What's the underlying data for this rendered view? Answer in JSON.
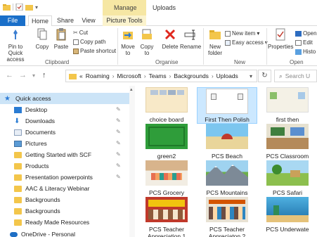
{
  "titlebar": {
    "manage_label": "Manage",
    "title": "Uploads"
  },
  "tabs": {
    "file": "File",
    "home": "Home",
    "share": "Share",
    "view": "View",
    "picture_tools": "Picture Tools"
  },
  "ribbon": {
    "pin_quick_access": "Pin to Quick access",
    "copy": "Copy",
    "paste": "Paste",
    "cut": "Cut",
    "copy_path": "Copy path",
    "paste_shortcut": "Paste shortcut",
    "move_to": "Move to",
    "copy_to": "Copy to",
    "delete": "Delete",
    "rename": "Rename",
    "new_folder": "New folder",
    "new_item": "New item",
    "easy_access": "Easy access",
    "properties": "Properties",
    "open": "Open",
    "edit": "Edit",
    "history": "Histo",
    "group_clipboard": "Clipboard",
    "group_organise": "Organise",
    "group_new": "New",
    "group_open": "Open"
  },
  "address": {
    "overflow": "«",
    "crumbs": [
      "Roaming",
      "Microsoft",
      "Teams",
      "Backgrounds",
      "Uploads"
    ],
    "search_placeholder": "Search U"
  },
  "nav": {
    "quick_access": "Quick access",
    "items": [
      "Desktop",
      "Downloads",
      "Documents",
      "Pictures",
      "Getting Started with SCF",
      "Products",
      "Presentation powerpoints",
      "AAC & Literacy Webinar",
      "Backgrounds",
      "Backgrounds",
      "Ready Made Resources"
    ],
    "onedrive": "OneDrive - Personal"
  },
  "files": [
    {
      "name": "choice board"
    },
    {
      "name": "First Then Polish"
    },
    {
      "name": "first then"
    },
    {
      "name": "green2"
    },
    {
      "name": "PCS Beach"
    },
    {
      "name": "PCS Classroom"
    },
    {
      "name": "PCS Grocery"
    },
    {
      "name": "PCS Mountains"
    },
    {
      "name": "PCS Safari"
    },
    {
      "name": "PCS Teacher Appreciation 1"
    },
    {
      "name": "PCS Teacher Appreciaton 2"
    },
    {
      "name": "PCS Underwate"
    }
  ],
  "colors": {
    "accent": "#1a6fc9",
    "selection": "#cce8ff",
    "context_tab": "#f6e7a4",
    "folder": "#f3c64b"
  }
}
